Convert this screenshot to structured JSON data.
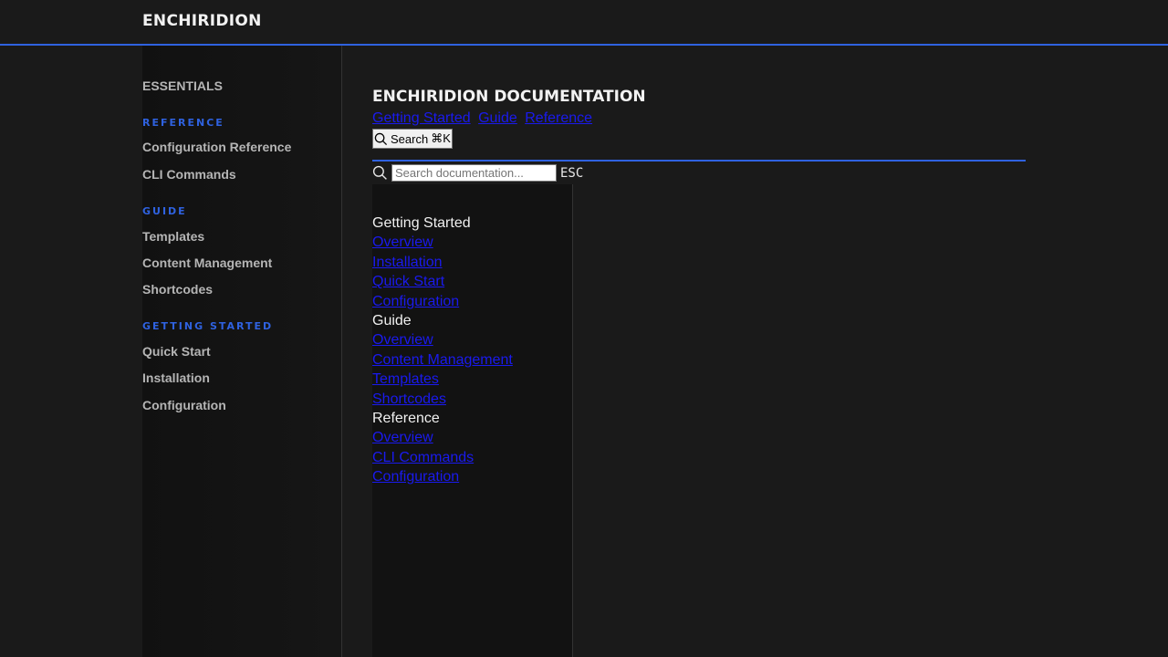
{
  "header": {
    "brand": "ENCHIRIDION"
  },
  "sidebar": {
    "section_title": "ESSENTIALS",
    "categories": [
      {
        "label": "REFERENCE",
        "items": [
          "Configuration Reference",
          "CLI Commands"
        ]
      },
      {
        "label": "GUIDE",
        "items": [
          "Templates",
          "Content Management",
          "Shortcodes"
        ]
      },
      {
        "label": "GETTING STARTED",
        "items": [
          "Quick Start",
          "Installation",
          "Configuration"
        ]
      }
    ]
  },
  "main": {
    "title": "ENCHIRIDION DOCUMENTATION",
    "nav_links": [
      "Getting Started",
      "Guide",
      "Reference"
    ],
    "search_button": {
      "label": "Search",
      "shortcut": "⌘K",
      "icon": "search-icon"
    },
    "search": {
      "placeholder": "Search documentation...",
      "value": "",
      "esc_label": "ESC",
      "icon": "search-icon"
    },
    "results": [
      {
        "group": "Getting Started",
        "links": [
          "Overview",
          "Installation",
          "Quick Start",
          "Configuration"
        ]
      },
      {
        "group": "Guide",
        "links": [
          "Overview",
          "Content Management",
          "Templates",
          "Shortcodes"
        ]
      },
      {
        "group": "Reference",
        "links": [
          "Overview",
          "CLI Commands",
          "Configuration"
        ]
      }
    ]
  },
  "colors": {
    "background": "#1a1a1a",
    "accent": "#2f62e0",
    "link": "#1a1aee",
    "text": "#b5b5b5"
  }
}
